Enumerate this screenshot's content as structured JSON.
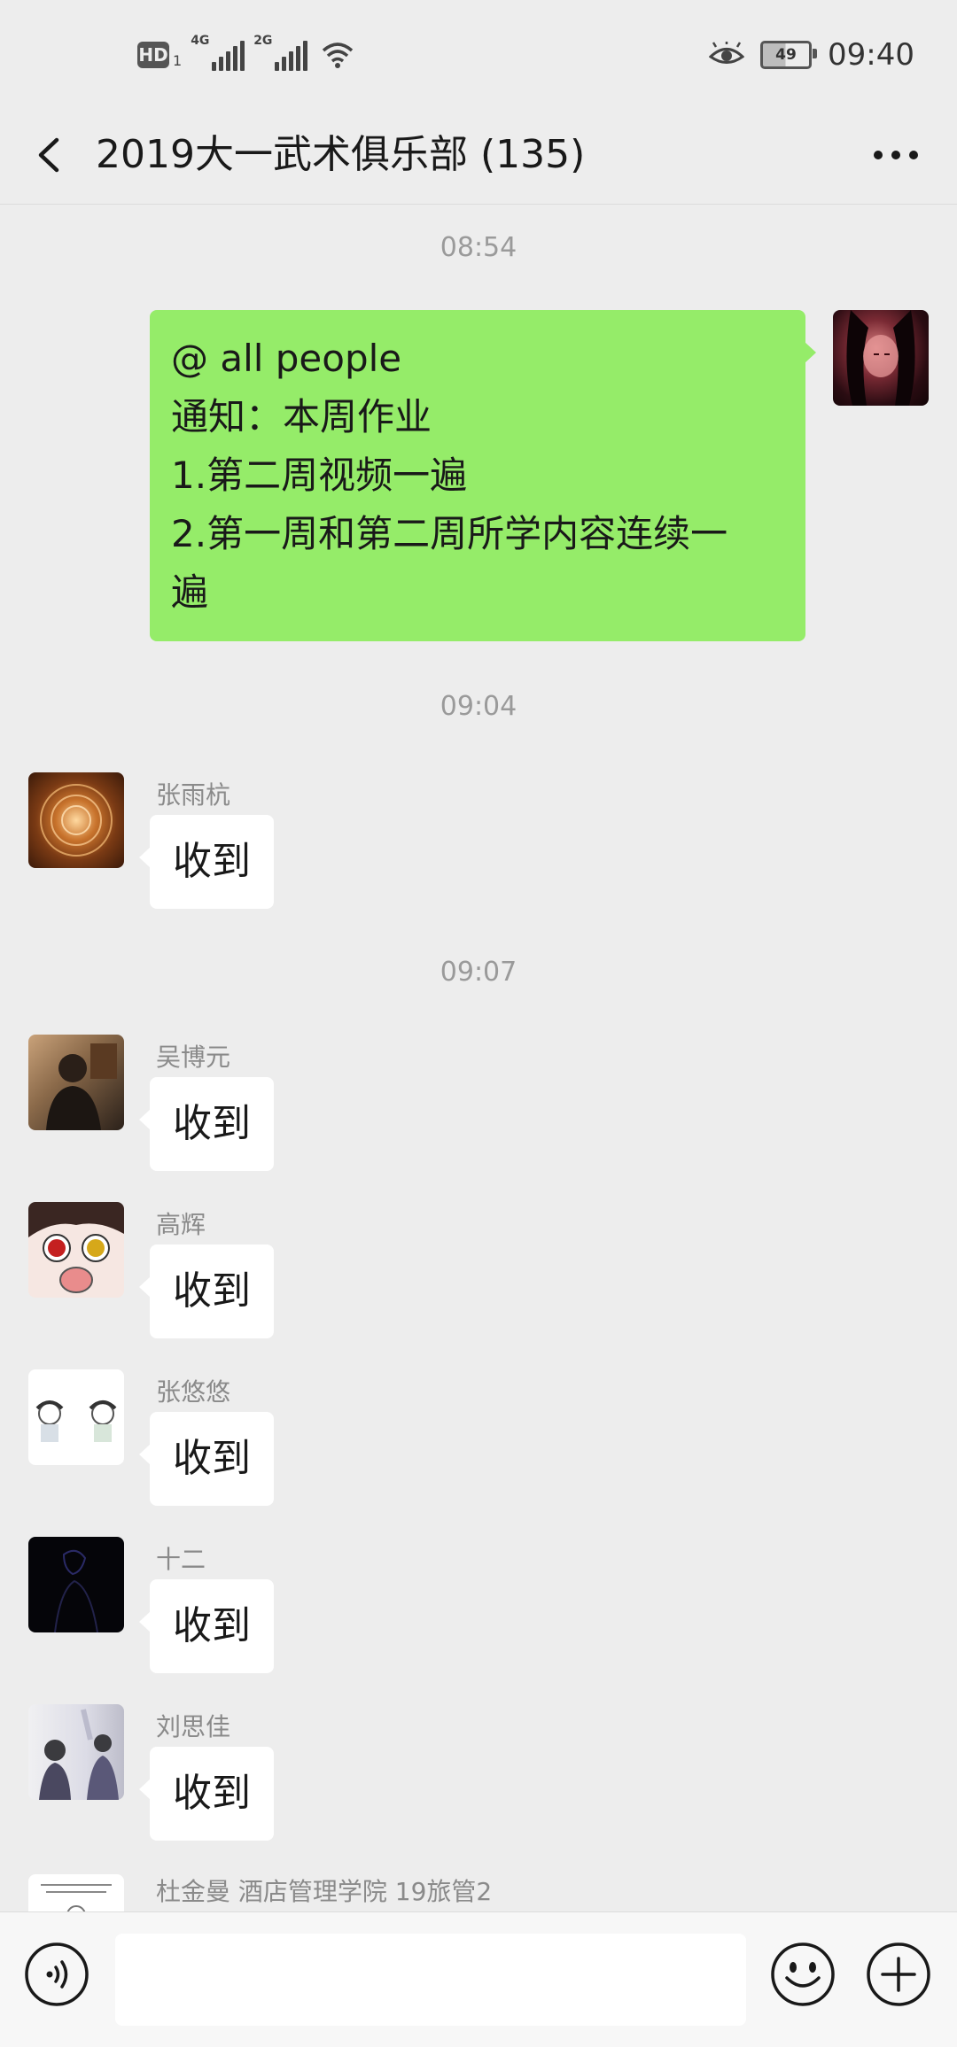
{
  "status_bar": {
    "hd_label": "HD",
    "sim_index": "1",
    "network_1": "4G",
    "network_2": "2G",
    "battery_level": "49",
    "time": "09:40"
  },
  "nav": {
    "title": "2019大一武术俱乐部 (135)"
  },
  "messages": [
    {
      "type": "time",
      "text": "08:54"
    },
    {
      "type": "self",
      "lines": [
        "@ all people",
        "通知：本周作业",
        "1.第二周视频一遍",
        "2.第一周和第二周所学内容连续一",
        "遍"
      ]
    },
    {
      "type": "time",
      "text": "09:04"
    },
    {
      "type": "other",
      "sender": "张雨杭",
      "text": "收到"
    },
    {
      "type": "time",
      "text": "09:07"
    },
    {
      "type": "other",
      "sender": "吴博元",
      "text": "收到"
    },
    {
      "type": "other",
      "sender": "高辉",
      "text": "收到"
    },
    {
      "type": "other",
      "sender": "张悠悠",
      "text": "收到"
    },
    {
      "type": "other",
      "sender": "十二",
      "text": "收到"
    },
    {
      "type": "other",
      "sender": "刘思佳",
      "text": "收到"
    },
    {
      "type": "other",
      "sender": "杜金曼 酒店管理学院 19旅管2",
      "text": ""
    }
  ],
  "input_bar": {
    "voice_icon": "voice-icon",
    "emoji_icon": "emoji-icon",
    "plus_icon": "plus-icon"
  },
  "colors": {
    "background": "#ededed",
    "self_bubble": "#95ec69",
    "other_bubble": "#ffffff"
  }
}
